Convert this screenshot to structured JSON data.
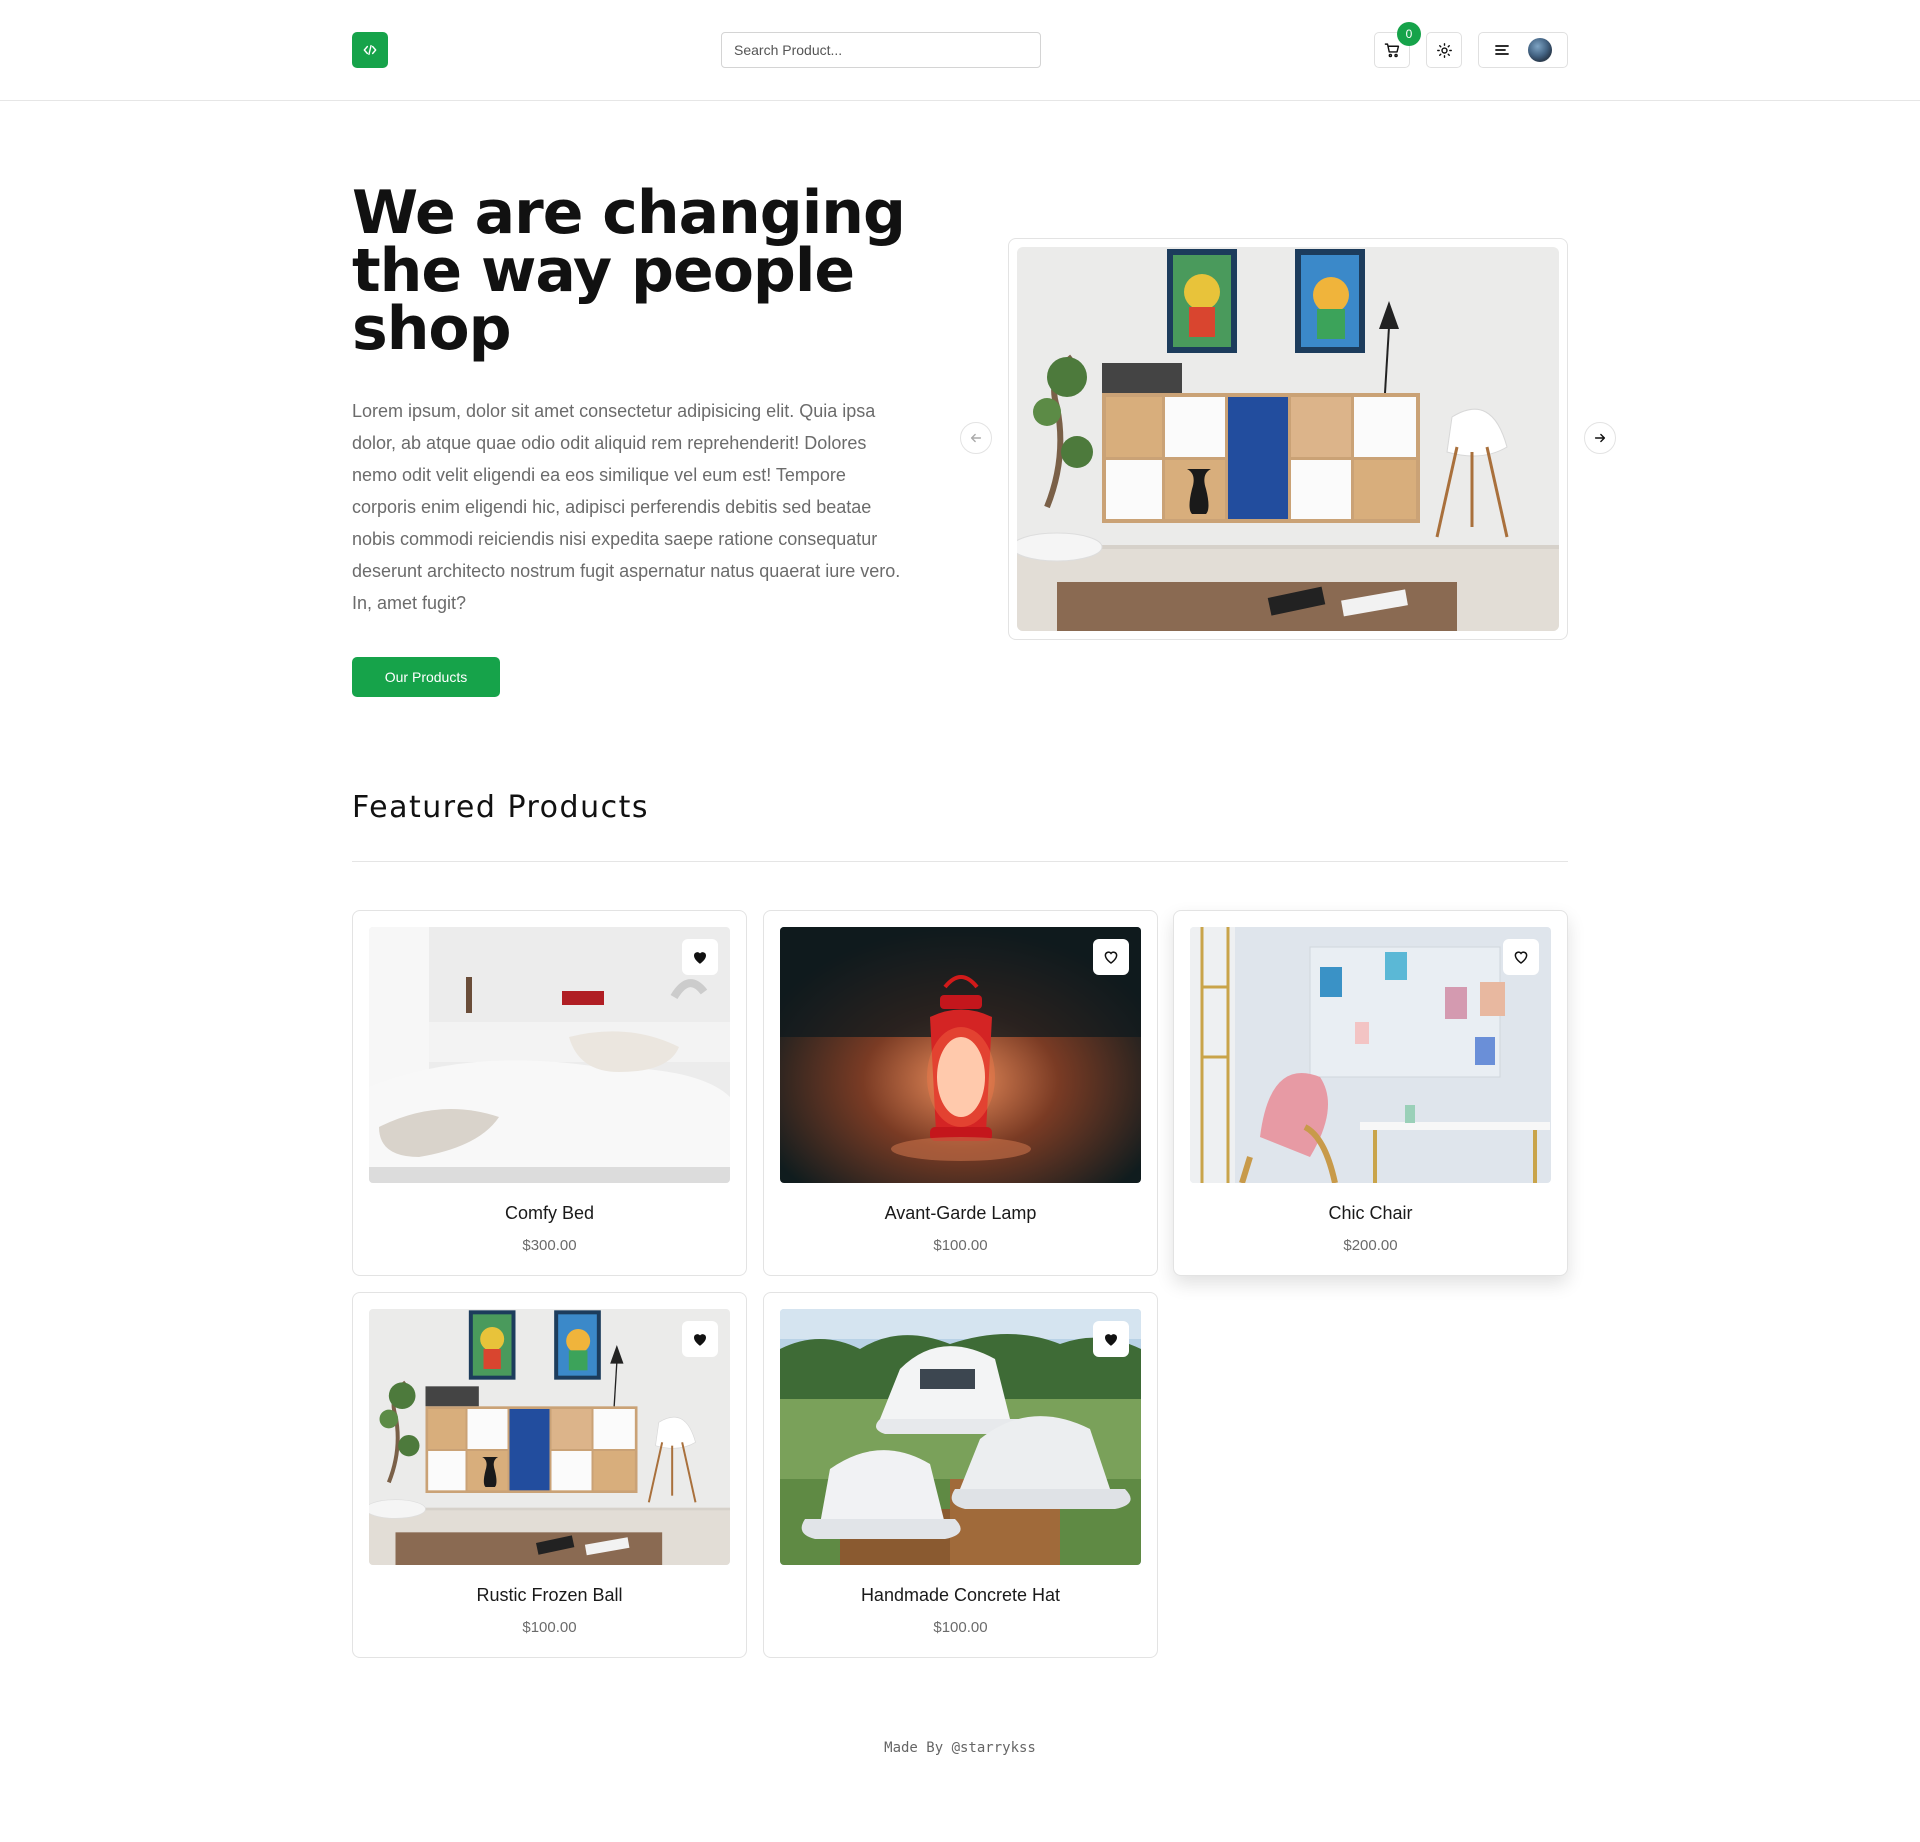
{
  "colors": {
    "accent": "#16a34a",
    "text": "#111111",
    "muted": "#6b6b6b",
    "border": "#e3e3e3"
  },
  "header": {
    "logo_icon": "code-icon",
    "search": {
      "placeholder": "Search Product..."
    },
    "cart": {
      "icon": "cart-icon",
      "count": "0"
    },
    "theme_icon": "sun-icon",
    "menu_icon": "menu-lines-icon"
  },
  "hero": {
    "title": "We are changing the way people shop",
    "description": "Lorem ipsum, dolor sit amet consectetur adipisicing elit. Quia ipsa dolor, ab atque quae odio odit aliquid rem reprehenderit! Dolores nemo odit velit eligendi ea eos similique vel eum est! Tempore corporis enim eligendi hic, adipisci perferendis debitis sed beatae nobis commodi reiciendis nisi expedita saepe ratione consequatur deserunt architecto nostrum fugit aspernatur natus quaerat iure vero. In, amet fugit?",
    "cta_label": "Our Products",
    "carousel": {
      "prev_icon": "arrow-left-icon",
      "next_icon": "arrow-right-icon",
      "image": "living-room-cabinet-photo"
    }
  },
  "featured": {
    "title": "Featured Products",
    "products": [
      {
        "name": "Comfy Bed",
        "price": "$300.00",
        "image": "white-bed-photo",
        "favorited": true
      },
      {
        "name": "Avant-Garde Lamp",
        "price": "$100.00",
        "image": "red-lantern-photo",
        "favorited": false
      },
      {
        "name": "Chic Chair",
        "price": "$200.00",
        "image": "desk-chair-photo",
        "favorited": false
      },
      {
        "name": "Rustic Frozen Ball",
        "price": "$100.00",
        "image": "living-room-cabinet-photo",
        "favorited": true
      },
      {
        "name": "Handmade Concrete Hat",
        "price": "$100.00",
        "image": "bucket-hats-photo",
        "favorited": true
      }
    ]
  },
  "footer": {
    "text": "Made By @starrykss"
  }
}
